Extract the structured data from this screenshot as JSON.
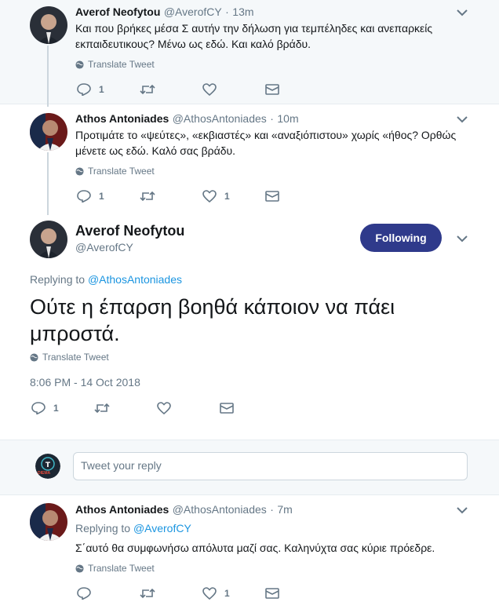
{
  "tweets": [
    {
      "name": "Averof Neofytou",
      "handle": "@AverofCY",
      "time": "13m",
      "text": "Και που βρήκες μέσα Σ αυτήν την δήλωση για τεμπέληδες και ανεπαρκείς εκπαιδευτικους? Μένω ως εδώ. Και καλό βράδυ.",
      "translate": "Translate Tweet",
      "replies": "1",
      "retweets": "",
      "likes": ""
    },
    {
      "name": "Athos Antoniades",
      "handle": "@AthosAntoniades",
      "time": "10m",
      "text": "Προτιμάτε το «ψεύτες», «εκβιαστές» και «αναξιόπιστου» χωρίς «ήθος? Ορθώς μένετε ως εδώ. Καλό σας βράδυ.",
      "translate": "Translate Tweet",
      "replies": "1",
      "retweets": "",
      "likes": "1"
    }
  ],
  "main_tweet": {
    "name": "Averof Neofytou",
    "handle": "@AverofCY",
    "follow_label": "Following",
    "replying_prefix": "Replying to",
    "replying_to": "@AthosAntoniades",
    "text": "Ούτε η έπαρση βοηθά κάποιον να πάει μπροστά.",
    "translate": "Translate Tweet",
    "timestamp": "8:06 PM - 14 Oct 2018",
    "replies": "1"
  },
  "reply_box": {
    "placeholder": "Tweet your reply",
    "avatar_text": "DIEMA"
  },
  "reply_tweet": {
    "name": "Athos Antoniades",
    "handle": "@AthosAntoniades",
    "time": "7m",
    "replying_prefix": "Replying to",
    "replying_to": "@AverofCY",
    "text": "Σ΄αυτό θα συμφωνήσω απόλυτα μαζί σας. Καληνύχτα σας κύριε πρόεδρε.",
    "translate": "Translate Tweet",
    "replies": "",
    "likes": "1"
  },
  "colors": {
    "follow_button": "#2f3a8b",
    "link": "#1b95e0",
    "muted": "#657786"
  }
}
